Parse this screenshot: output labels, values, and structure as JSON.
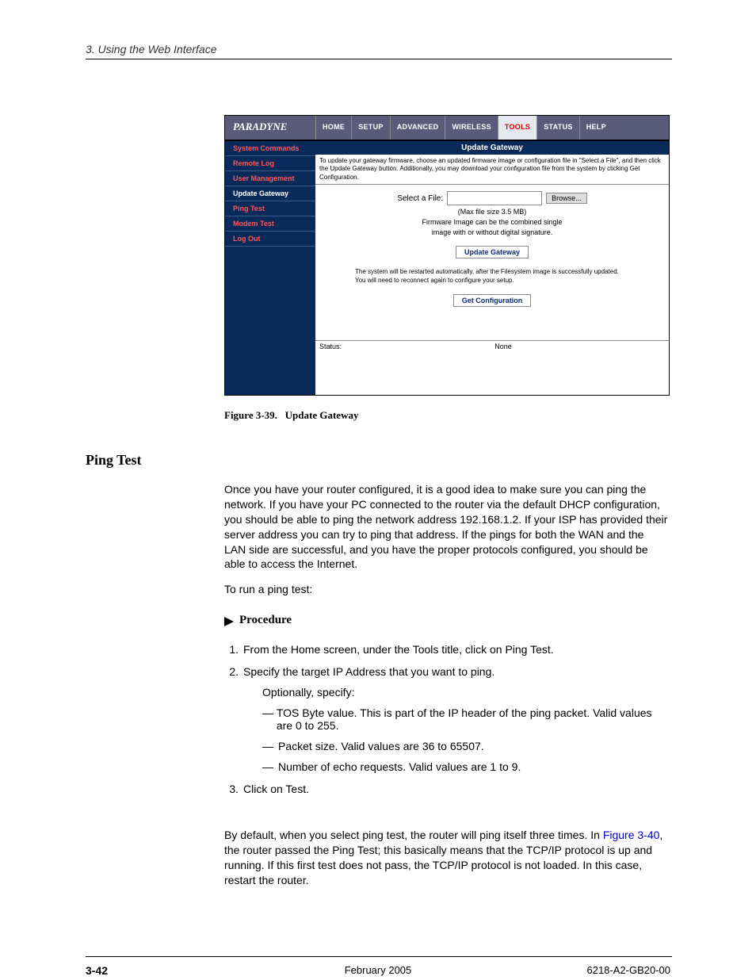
{
  "header": {
    "chapter": "3. Using the Web Interface"
  },
  "screenshot": {
    "logo": "PARADYNE",
    "nav": {
      "home": "HOME",
      "setup": "SETUP",
      "advanced": "ADVANCED",
      "wireless": "WIRELESS",
      "tools": "TOOLS",
      "status": "STATUS",
      "help": "HELP"
    },
    "sidebar": {
      "system_commands": "System Commands",
      "remote_log": "Remote Log",
      "user_management": "User Management",
      "update_gateway": "Update Gateway",
      "ping_test": "Ping Test",
      "modem_test": "Modem Test",
      "log_out": "Log Out"
    },
    "content": {
      "title": "Update Gateway",
      "desc": "To update your gateway firmware, choose an updated firmware image or configuration file in \"Select a File\", and then click the Update Gateway button. Additionally, you may download your configuration file from the system by clicking Get Configuration.",
      "select_label": "Select a File:",
      "browse": "Browse...",
      "max_size": "(Max file size 3.5 MB)",
      "fw_note1": "Firmware Image can be the combined single",
      "fw_note2": "image with or without digital signature.",
      "update_btn": "Update Gateway",
      "restart_note": "The system will be restarted automatically, after the Filesystem image is successfully updated. You will need to reconnect again to configure your setup.",
      "get_config_btn": "Get Configuration",
      "status_label": "Status:",
      "status_value": "None"
    }
  },
  "figure": {
    "label": "Figure 3-39.",
    "title": "Update Gateway"
  },
  "section": {
    "heading": "Ping Test"
  },
  "body": {
    "para1": "Once you have your router configured, it is a good idea to make sure you can ping the network. If you have your PC connected to the router via the default DHCP configuration, you should be able to ping the network address 192.168.1.2. If your ISP has provided their server address you can try to ping that address. If the pings for both the WAN and the LAN side are successful, and you have the proper protocols configured, you should be able to access the Internet.",
    "para2": "To run a ping test:",
    "procedure": "Procedure",
    "steps": {
      "s1": "From the Home screen, under the Tools title, click on Ping Test.",
      "s2": "Specify the target IP Address that you want to ping.",
      "s2_opt": "Optionally, specify:",
      "s2_a": "TOS Byte value. This is part of the IP header of the ping packet. Valid values are 0 to 255.",
      "s2_b": "Packet size. Valid values are 36 to 65507.",
      "s2_c": "Number of echo requests. Valid values are 1 to 9.",
      "s3": "Click on Test."
    },
    "para3_pre": "By default, when you select ping test, the router will ping itself three times. In ",
    "para3_link": "Figure 3-40",
    "para3_post": ", the router passed the Ping Test; this basically means that the TCP/IP protocol is up and running. If this first test does not pass, the TCP/IP protocol is not loaded. In this case, restart the router."
  },
  "footer": {
    "page": "3-42",
    "date": "February 2005",
    "docnum": "6218-A2-GB20-00"
  }
}
